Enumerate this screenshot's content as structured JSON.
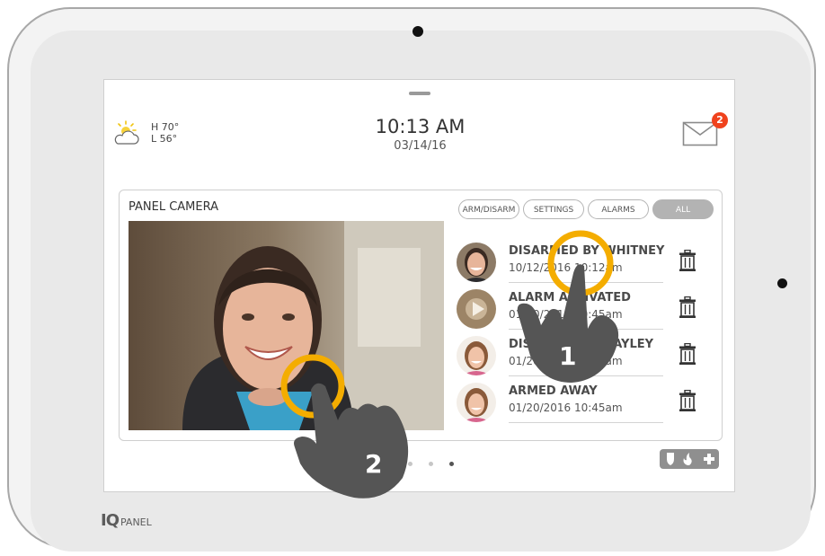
{
  "weather": {
    "high": "H 70°",
    "low": "L 56°",
    "icon": "partly-cloudy-icon"
  },
  "clock": {
    "time": "10:13 AM",
    "date": "03/14/16"
  },
  "notifications": {
    "count": "2",
    "icon": "mail-icon"
  },
  "panel_camera": {
    "title": "PANEL CAMERA",
    "filters": [
      {
        "label": "ARM/DISARM",
        "active": false
      },
      {
        "label": "SETTINGS",
        "active": false
      },
      {
        "label": "ALARMS",
        "active": false
      },
      {
        "label": "ALL",
        "active": true
      }
    ],
    "events": [
      {
        "title": "DISARMED BY WHITNEY",
        "time": "10/12/2016 10:12am",
        "avatar": "woman-avatar"
      },
      {
        "title": "ALARM ACTIVATED",
        "time": "01/20/2016 10:45am",
        "avatar": "video-play-avatar"
      },
      {
        "title": "DISARMED BY HAYLEY",
        "time": "01/20/2016 10:45am",
        "avatar": "girl-avatar"
      },
      {
        "title": "ARMED AWAY",
        "time": "01/20/2016 10:45am",
        "avatar": "girl-avatar"
      }
    ]
  },
  "pagination": {
    "count": 4,
    "active_index": 3
  },
  "emergency": {
    "icons": [
      "shield-icon",
      "fire-icon",
      "medical-cross-icon"
    ]
  },
  "gestures": [
    {
      "label": "1"
    },
    {
      "label": "2"
    }
  ],
  "branding": {
    "logo_mark": "IQ",
    "logo_text": "PANEL"
  },
  "colors": {
    "badge": "#f0421d",
    "gesture_ring": "#f4ad00",
    "hand": "#555555"
  }
}
